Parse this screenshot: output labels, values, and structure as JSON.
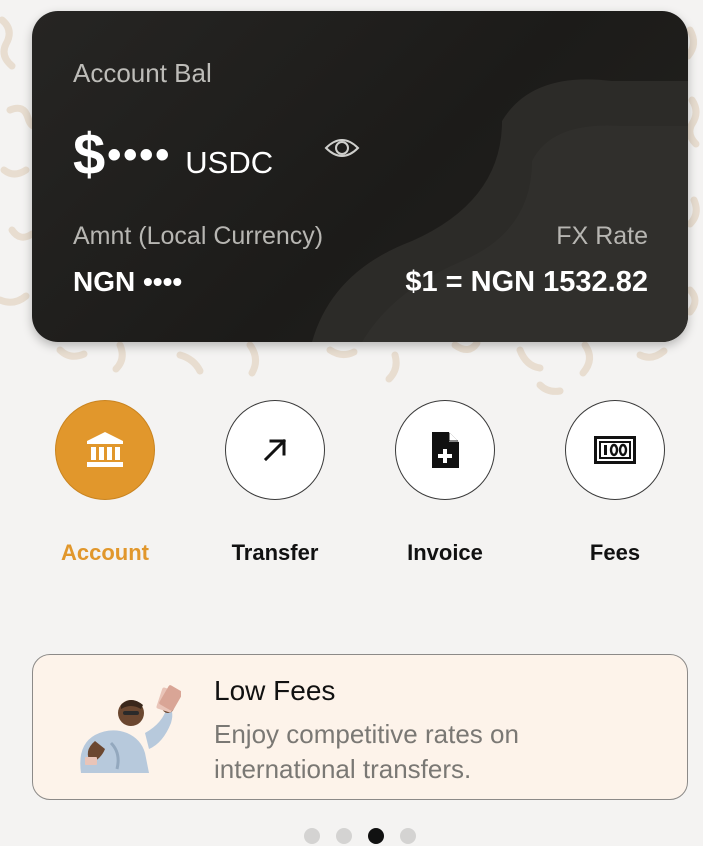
{
  "balance_card": {
    "title": "Account Bal",
    "currency_symbol": "$",
    "balance_masked": "••••",
    "balance_currency": "USDC",
    "local_currency_label": "Amnt (Local Currency)",
    "local_currency_value": "NGN ••••",
    "fx_rate_label": "FX Rate",
    "fx_rate_value": "$1 = NGN 1532.82",
    "visibility_icon": "eye-icon"
  },
  "actions": [
    {
      "label": "Account",
      "icon": "bank-icon",
      "active": true
    },
    {
      "label": "Transfer",
      "icon": "arrow-up-right-icon",
      "active": false
    },
    {
      "label": "Invoice",
      "icon": "add-document-icon",
      "active": false
    },
    {
      "label": "Fees",
      "icon": "banknote-icon",
      "active": false
    }
  ],
  "promo": {
    "title": "Low Fees",
    "body": "Enjoy competitive rates on international transfers."
  },
  "pager": {
    "total": 4,
    "active_index": 2
  },
  "colors": {
    "accent": "#e1972c",
    "card_background": "#1f1e1c",
    "promo_background": "#fdf3ea",
    "page_background": "#f4f3f2"
  }
}
